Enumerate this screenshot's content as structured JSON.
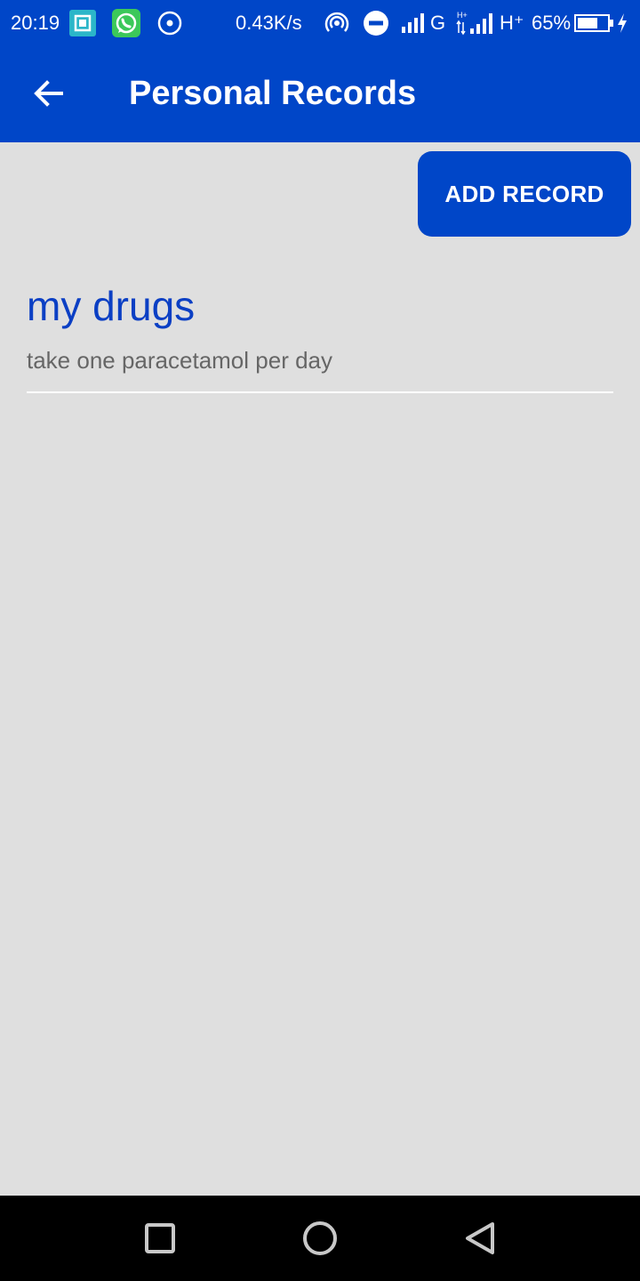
{
  "status_bar": {
    "time": "20:19",
    "speed": "0.43K/s",
    "net_g": "G",
    "net_h": "H⁺",
    "battery": "65%",
    "icons": [
      "screenshot-icon",
      "whatsapp-icon",
      "record-dot-icon",
      "hotspot-icon",
      "do-not-disturb-icon",
      "signal-icon",
      "signal-icon",
      "battery-icon",
      "charging-icon"
    ]
  },
  "app_bar": {
    "title": "Personal Records",
    "back_icon": "arrow-back-icon"
  },
  "actions": {
    "add_record_label": "ADD RECORD"
  },
  "records": [
    {
      "title": "my drugs",
      "description": "take one paracetamol per day"
    }
  ],
  "nav_bar": {
    "icons": [
      "recents-square-icon",
      "home-circle-icon",
      "back-triangle-icon"
    ]
  },
  "colors": {
    "primary": "#0046c8",
    "background": "#dfdfdf",
    "record_title": "#0b3fc4",
    "record_desc": "#666666"
  }
}
